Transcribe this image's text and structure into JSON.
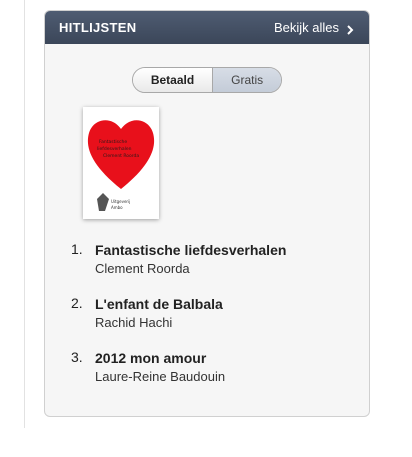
{
  "panel": {
    "title": "HITLIJSTEN",
    "see_all": "Bekijk alles"
  },
  "toggle": {
    "paid": "Betaald",
    "free": "Gratis",
    "selected": "Betaald"
  },
  "cover": {
    "heart_text": "Fantastische liefdesverhalen Clement Roorda",
    "publisher": "Uitgeverij Ambo"
  },
  "books": [
    {
      "rank": "1.",
      "title": "Fantastische liefdesverhalen",
      "author": "Clement Roorda"
    },
    {
      "rank": "2.",
      "title": "L'enfant de Balbala",
      "author": "Rachid Hachi"
    },
    {
      "rank": "3.",
      "title": "2012 mon amour",
      "author": "Laure-Reine Baudouin"
    }
  ],
  "colors": {
    "header_bg": "#3b4659",
    "heart_red": "#e8101b",
    "panel_bg": "#f6f6f6"
  }
}
